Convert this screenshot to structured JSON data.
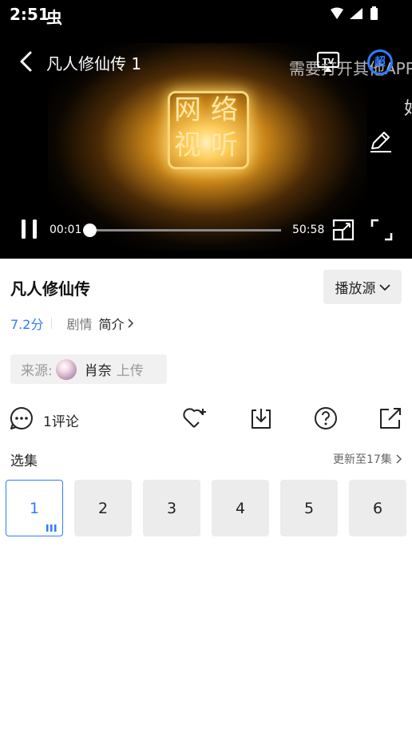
{
  "status_bar": {
    "time": "2:51",
    "bug_glyph": "虫"
  },
  "player": {
    "title": "凡人修仙传 1",
    "marquee_line1": "需要打开其他APP",
    "marquee_line2": "好",
    "logo_chars": [
      "网",
      "络",
      "视",
      "听"
    ],
    "current_time": "00:01",
    "duration": "50:58",
    "progress": 0.0003,
    "hd_badge": "超",
    "state": "playing"
  },
  "info": {
    "title": "凡人修仙传",
    "source_button": "播放源",
    "score": "7.2分",
    "genre": "剧情",
    "intro_link": "简介",
    "origin_label": "来源:",
    "uploader": "肖奈",
    "upload_suffix": "上传"
  },
  "actions": {
    "comments": "1评论",
    "icons": [
      "heart-add-icon",
      "download-icon",
      "help-icon",
      "share-icon"
    ]
  },
  "episodes": {
    "section_title": "选集",
    "update_text": "更新至17集",
    "items": [
      "1",
      "2",
      "3",
      "4",
      "5",
      "6"
    ],
    "active": "1"
  },
  "colors": {
    "accent": "#2f7bff",
    "player_bg": "#000000",
    "chip_bg": "#ececec"
  }
}
